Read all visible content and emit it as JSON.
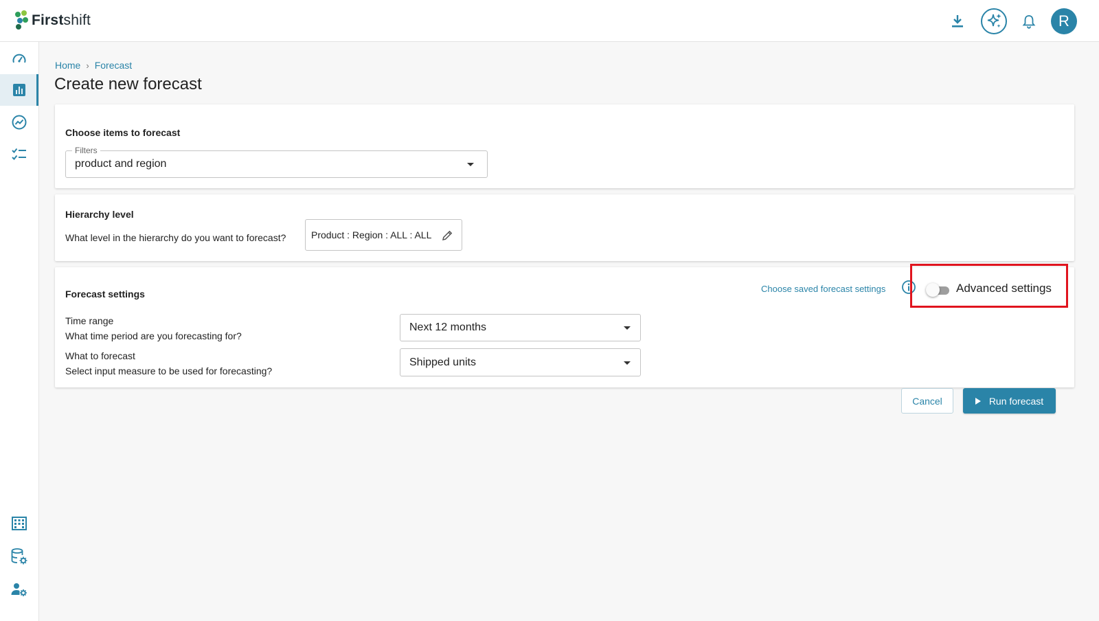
{
  "brand": {
    "name_bold": "First",
    "name_regular": "shift",
    "accent": "#2a84a8",
    "logo_dot_colors": [
      "#2e9e5b",
      "#8cc63f",
      "#2a84a8",
      "#1f6b4a"
    ]
  },
  "header": {
    "icons": [
      "download-icon",
      "ai-sparkle-icon",
      "bell-icon"
    ],
    "avatar_initial": "R"
  },
  "sidebar": {
    "items": [
      {
        "icon": "gauge-icon",
        "active": false
      },
      {
        "icon": "bar-chart-icon",
        "active": true
      },
      {
        "icon": "trend-icon",
        "active": false
      },
      {
        "icon": "checklist-icon",
        "active": false
      }
    ],
    "bottom_items": [
      {
        "icon": "building-icon"
      },
      {
        "icon": "database-settings-icon"
      },
      {
        "icon": "user-settings-icon"
      }
    ]
  },
  "breadcrumb": {
    "items": [
      "Home",
      "Forecast"
    ],
    "separator": "›"
  },
  "page": {
    "title": "Create new forecast"
  },
  "choose_items": {
    "heading": "Choose items to forecast",
    "filters_label": "Filters",
    "filters_value": "product and region"
  },
  "hierarchy": {
    "heading": "Hierarchy level",
    "question": "What level in the hierarchy do you want to forecast?",
    "value": "Product : Region : ALL : ALL"
  },
  "forecast_settings": {
    "heading": "Forecast settings",
    "saved_settings_link": "Choose saved forecast settings",
    "advanced_label": "Advanced settings",
    "advanced_enabled": false,
    "highlight_color": "#e0141e",
    "time_range": {
      "label": "Time range",
      "question": "What time period are you forecasting for?",
      "value": "Next 12 months"
    },
    "what_to_forecast": {
      "label": "What to forecast",
      "question": "Select input measure to be used for forecasting?",
      "value": "Shipped units"
    }
  },
  "actions": {
    "cancel_label": "Cancel",
    "run_label": "Run forecast"
  }
}
